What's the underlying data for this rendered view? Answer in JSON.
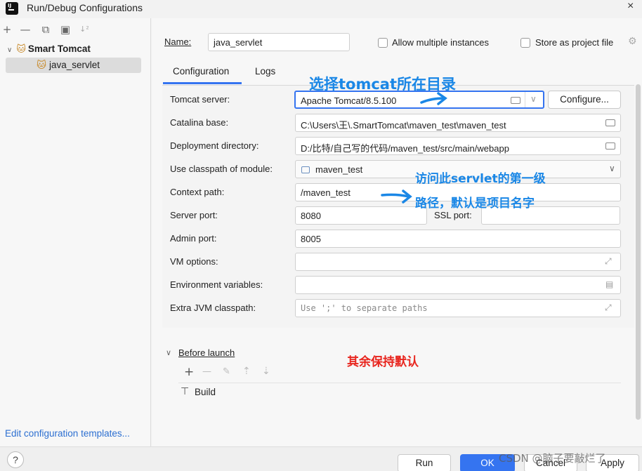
{
  "window": {
    "title": "Run/Debug Configurations",
    "close": "×"
  },
  "left": {
    "toolbar": [
      "+",
      "—",
      "⧉",
      "▣",
      "↓²"
    ],
    "tree_root": "Smart Tomcat",
    "tree_child": "java_servlet",
    "edit_templates": "Edit configuration templates..."
  },
  "header": {
    "name_label": "Name:",
    "name_value": "java_servlet",
    "allow_multiple": "Allow multiple instances",
    "store_project": "Store as project file"
  },
  "tabs": [
    "Configuration",
    "Logs"
  ],
  "fields": {
    "tomcat_server_label": "Tomcat server:",
    "tomcat_server_value": "Apache Tomcat/8.5.100",
    "configure_button": "Configure...",
    "catalina_label": "Catalina base:",
    "catalina_value": "C:\\Users\\王\\.SmartTomcat\\maven_test\\maven_test",
    "deploy_label": "Deployment directory:",
    "deploy_value": "D:/比特/自己写的代码/maven_test/src/main/webapp",
    "classpath_label": "Use classpath of module:",
    "classpath_value": "maven_test",
    "context_label": "Context path:",
    "context_value": "/maven_test",
    "server_port_label": "Server port:",
    "server_port_value": "8080",
    "ssl_port_label": "SSL port:",
    "admin_port_label": "Admin port:",
    "admin_port_value": "8005",
    "vm_label": "VM options:",
    "env_label": "Environment variables:",
    "jvm_label": "Extra JVM classpath:",
    "jvm_placeholder": "Use ';' to separate paths"
  },
  "before_launch": {
    "title": "Before launch",
    "toolbar": [
      "+",
      "—",
      "✎",
      "⇡",
      "⇣"
    ],
    "item": "Build"
  },
  "annotations": {
    "select_dir": "选择tomcat所在目录",
    "path_line1": "访问此servlet的第一级",
    "path_line2": "路径，默认是项目名字",
    "keep_default": "其余保持默认"
  },
  "bottom": {
    "help": "?",
    "run": "Run",
    "ok": "OK",
    "cancel": "Cancel",
    "apply": "Apply",
    "watermark": "CSDN @脑子要敲烂了"
  },
  "colors": {
    "accent": "#3574f0",
    "annotation_blue": "#1a87e6",
    "annotation_red": "#e8251e"
  }
}
